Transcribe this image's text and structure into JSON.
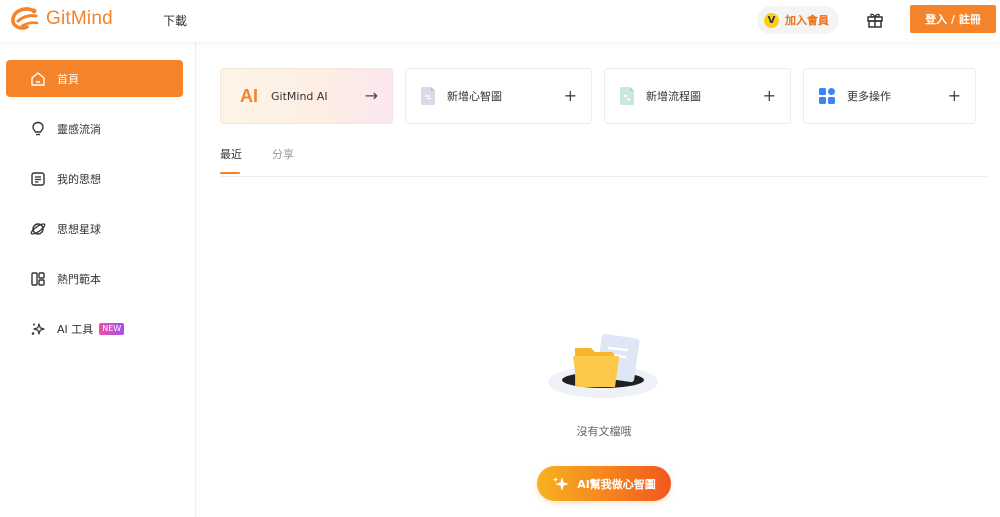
{
  "header": {
    "logo_text": "GitMind",
    "download_label": "下載",
    "vip_badge_text": "V",
    "vip_label": "加入會員",
    "login_label": "登入 / 註冊"
  },
  "sidebar": {
    "items": [
      {
        "label": "首頁",
        "icon": "home-icon",
        "active": true
      },
      {
        "label": "靈感流淌",
        "icon": "lightbulb-icon"
      },
      {
        "label": "我的思想",
        "icon": "document-icon"
      },
      {
        "label": "思想星球",
        "icon": "planet-icon"
      },
      {
        "label": "熱門範本",
        "icon": "template-grid-icon"
      },
      {
        "label": "AI 工具",
        "icon": "sparkle-icon",
        "badge": "NEW"
      }
    ]
  },
  "cards": [
    {
      "label": "GitMind AI",
      "icon_text": "AI",
      "trail": "→"
    },
    {
      "label": "新增心智圖",
      "icon": "mindmap-file-icon",
      "trail": "+"
    },
    {
      "label": "新增流程圖",
      "icon": "flowchart-file-icon",
      "trail": "+"
    },
    {
      "label": "更多操作",
      "icon": "apps-grid-icon",
      "trail": "+"
    }
  ],
  "tabs": [
    {
      "label": "最近",
      "active": true
    },
    {
      "label": "分享"
    }
  ],
  "empty": {
    "text": "沒有文檔哦",
    "button_label": "AI幫我做心智圖"
  },
  "colors": {
    "brand": "#f48329",
    "vip_yellow": "#fcd012",
    "new_badge": "#d14fd0"
  }
}
